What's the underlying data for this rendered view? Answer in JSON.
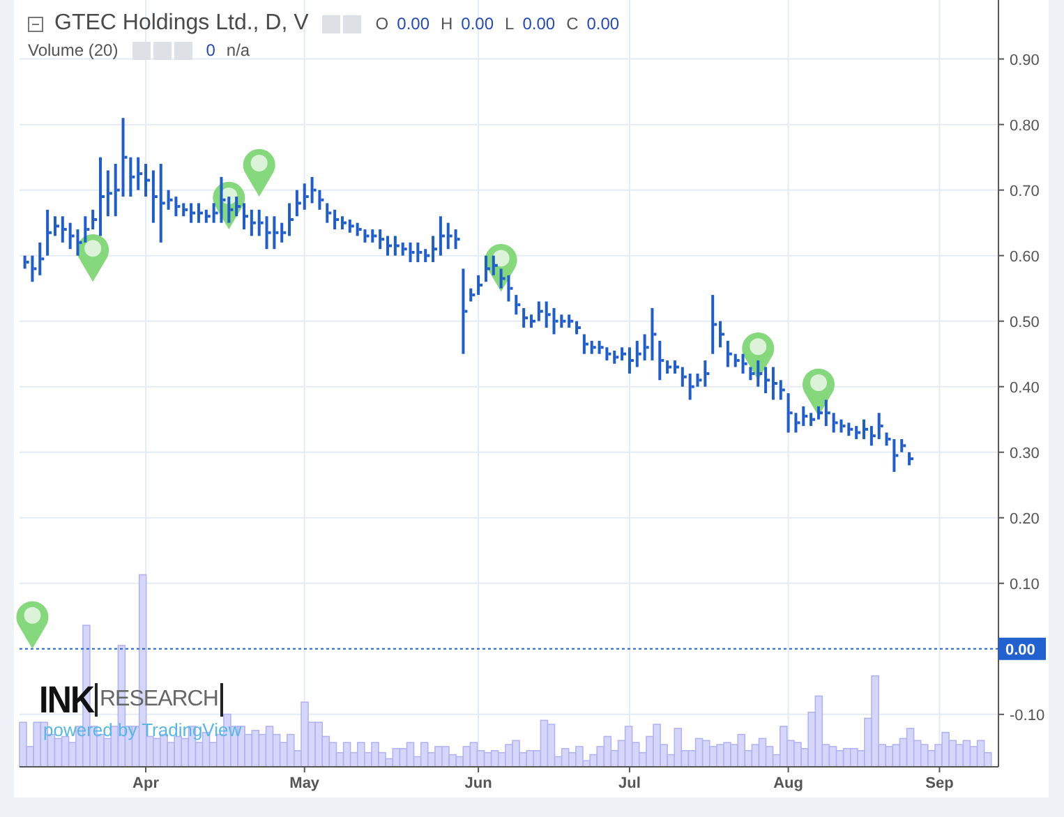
{
  "legend": {
    "title": "GTEC Holdings Ltd., D, V",
    "ohlc": [
      {
        "label": "O",
        "value": "0.00"
      },
      {
        "label": "H",
        "value": "0.00"
      },
      {
        "label": "L",
        "value": "0.00"
      },
      {
        "label": "C",
        "value": "0.00"
      }
    ]
  },
  "volume_legend": {
    "title": "Volume (20)",
    "value": "0",
    "reading": "n/a"
  },
  "branding": {
    "logo_bold": "INK",
    "logo_light": "RESEARCH",
    "powered_by": "powered by TradingView"
  },
  "price_chart": {
    "chart_data": {
      "type": "scatter",
      "grid": true,
      "ylim": [
        -0.18,
        0.99
      ],
      "categories": [
        null,
        null,
        null,
        null,
        null,
        null,
        null,
        null,
        null,
        null,
        null,
        null,
        null,
        null,
        null,
        null,
        "Apr",
        null,
        null,
        null,
        null,
        null,
        null,
        null,
        null,
        null,
        null,
        null,
        null,
        null,
        null,
        null,
        null,
        null,
        null,
        null,
        null,
        "May",
        null,
        null,
        null,
        null,
        null,
        null,
        null,
        null,
        null,
        null,
        null,
        null,
        null,
        null,
        null,
        null,
        null,
        null,
        null,
        null,
        null,
        null,
        "Jun",
        null,
        null,
        null,
        null,
        null,
        null,
        null,
        null,
        null,
        null,
        null,
        null,
        null,
        null,
        null,
        null,
        null,
        null,
        null,
        "Jul",
        null,
        null,
        null,
        null,
        null,
        null,
        null,
        null,
        null,
        null,
        null,
        null,
        null,
        null,
        null,
        null,
        null,
        null,
        null,
        null,
        "Aug",
        null,
        null,
        null,
        null,
        null,
        null,
        null,
        null,
        null,
        null,
        null,
        null,
        null,
        null,
        null,
        null,
        null,
        null,
        null,
        "Sep"
      ],
      "ref_lines": [
        {
          "axis": "y",
          "value": 0,
          "label": "0.00",
          "color": "#2162d0"
        }
      ],
      "yticks": [
        {
          "value": 0.9,
          "label": "0.90"
        },
        {
          "value": 0.8,
          "label": "0.80"
        },
        {
          "value": 0.7,
          "label": "0.70"
        },
        {
          "value": 0.6,
          "label": "0.60"
        },
        {
          "value": 0.5,
          "label": "0.50"
        },
        {
          "value": 0.4,
          "label": "0.40"
        },
        {
          "value": 0.3,
          "label": "0.30"
        },
        {
          "value": 0.2,
          "label": "0.20"
        },
        {
          "value": 0.1,
          "label": "0.10"
        },
        {
          "value": -0.1,
          "label": "-0.10"
        }
      ],
      "series": [
        {
          "color": "#1f5ccc",
          "values": [
            0.59,
            0.58,
            0.595,
            0.635,
            0.645,
            0.64,
            0.63,
            0.62,
            0.64,
            0.655,
            0.69,
            0.695,
            0.7,
            0.75,
            0.72,
            0.725,
            0.715,
            0.69,
            0.68,
            0.685,
            0.675,
            0.67,
            0.665,
            0.665,
            0.66,
            0.665,
            0.685,
            0.67,
            0.675,
            0.66,
            0.65,
            0.65,
            0.635,
            0.635,
            0.635,
            0.655,
            0.68,
            0.69,
            0.7,
            0.685,
            0.665,
            0.655,
            0.65,
            0.645,
            0.64,
            0.63,
            0.63,
            0.625,
            0.615,
            0.615,
            0.61,
            0.605,
            0.605,
            0.6,
            0.61,
            0.63,
            0.63,
            0.625,
            0.515,
            0.54,
            0.555,
            0.58,
            0.585,
            0.565,
            0.55,
            0.525,
            0.505,
            0.5,
            0.515,
            0.51,
            0.5,
            0.5,
            0.5,
            0.49,
            0.465,
            0.46,
            0.46,
            0.45,
            0.445,
            0.45,
            0.44,
            0.45,
            0.46,
            0.48,
            0.44,
            0.43,
            0.43,
            0.415,
            0.4,
            0.41,
            0.42,
            0.495,
            0.48,
            0.45,
            0.44,
            0.435,
            0.42,
            0.42,
            0.41,
            0.405,
            0.395,
            0.36,
            0.345,
            0.355,
            0.35,
            0.36,
            0.36,
            0.345,
            0.34,
            0.335,
            0.33,
            0.335,
            0.325,
            0.34,
            0.32,
            0.295,
            0.31,
            0.29,
            null,
            null,
            null,
            null
          ],
          "errors": [
            0.01,
            0.02,
            0.025,
            0.035,
            0.015,
            0.02,
            0.02,
            0.02,
            0.02,
            0.015,
            0.06,
            0.035,
            0.04,
            0.06,
            0.03,
            0.025,
            0.025,
            0.04,
            0.06,
            0.015,
            0.015,
            0.01,
            0.015,
            0.015,
            0.01,
            0.015,
            0.035,
            0.02,
            0.015,
            0.02,
            0.02,
            0.02,
            0.025,
            0.025,
            0.015,
            0.025,
            0.02,
            0.02,
            0.02,
            0.015,
            0.015,
            0.015,
            0.01,
            0.01,
            0.01,
            0.01,
            0.01,
            0.015,
            0.015,
            0.015,
            0.01,
            0.015,
            0.015,
            0.01,
            0.02,
            0.03,
            0.02,
            0.015,
            0.065,
            0.01,
            0.015,
            0.02,
            0.015,
            0.015,
            0.02,
            0.015,
            0.015,
            0.01,
            0.015,
            0.02,
            0.02,
            0.01,
            0.01,
            0.01,
            0.015,
            0.01,
            0.01,
            0.01,
            0.01,
            0.01,
            0.02,
            0.02,
            0.02,
            0.04,
            0.03,
            0.01,
            0.01,
            0.015,
            0.02,
            0.01,
            0.02,
            0.045,
            0.02,
            0.02,
            0.01,
            0.015,
            0.01,
            0.02,
            0.02,
            0.025,
            0.015,
            0.03,
            0.015,
            0.015,
            0.01,
            0.01,
            0.02,
            0.015,
            0.01,
            0.01,
            0.01,
            0.015,
            0.015,
            0.02,
            0.01,
            0.025,
            0.01,
            0.01,
            null,
            null,
            null,
            null
          ]
        }
      ]
    }
  }
}
